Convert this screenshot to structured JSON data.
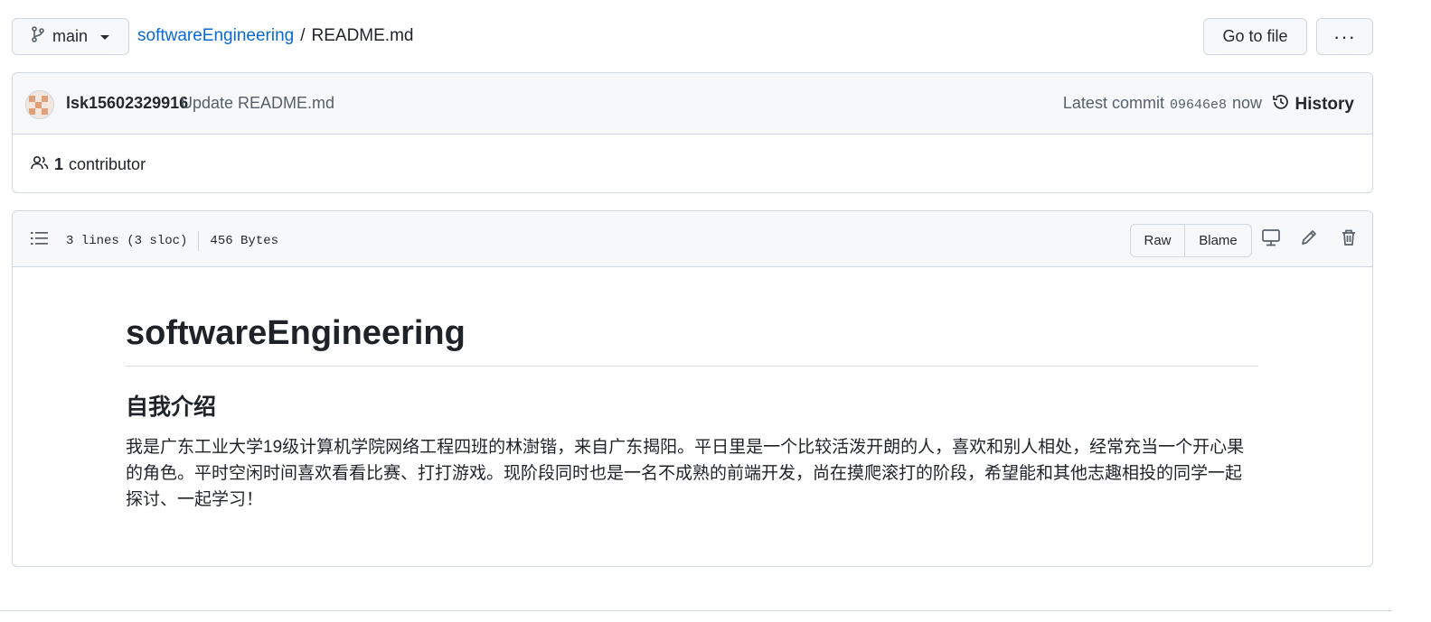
{
  "branch": {
    "name": "main"
  },
  "breadcrumb": {
    "repo": "softwareEngineering",
    "separator": "/",
    "file": "README.md"
  },
  "header_actions": {
    "go_to_file": "Go to file",
    "more": "···"
  },
  "commit": {
    "author": "lsk15602329916",
    "message": "Update README.md",
    "latest_label": "Latest commit",
    "sha": "09646e8",
    "time": "now",
    "history_label": "History"
  },
  "contributors": {
    "count": "1",
    "label": "contributor"
  },
  "file": {
    "lines": "3 lines (3 sloc)",
    "size": "456 Bytes",
    "raw_label": "Raw",
    "blame_label": "Blame"
  },
  "readme": {
    "title": "softwareEngineering",
    "section_heading": "自我介绍",
    "paragraph": "我是广东工业大学19级计算机学院网络工程四班的林澍锴，来自广东揭阳。平日里是一个比较活泼开朗的人，喜欢和别人相处，经常充当一个开心果的角色。平时空闲时间喜欢看看比赛、打打游戏。现阶段同时也是一名不成熟的前端开发，尚在摸爬滚打的阶段，希望能和其他志趣相投的同学一起探讨、一起学习！"
  },
  "colors": {
    "link": "#0969da",
    "border": "#d0d7de",
    "header_bg": "#f6f8fa"
  }
}
